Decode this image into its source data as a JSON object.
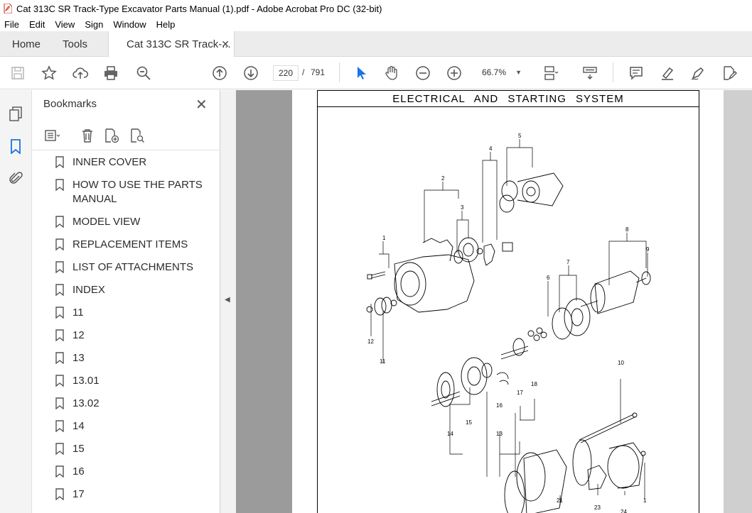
{
  "window": {
    "title": "Cat 313C SR Track-Type Excavator Parts Manual (1).pdf - Adobe Acrobat Pro DC (32-bit)"
  },
  "menu": [
    "File",
    "Edit",
    "View",
    "Sign",
    "Window",
    "Help"
  ],
  "tabs": {
    "home": "Home",
    "tools": "Tools",
    "document": "Cat 313C SR Track-..."
  },
  "toolbar": {
    "current_page": "220",
    "separator": "/",
    "total_pages": "791",
    "zoom": "66.7%"
  },
  "bookmarks": {
    "title": "Bookmarks",
    "items": [
      "INNER COVER",
      "HOW TO USE THE PARTS MANUAL",
      "MODEL VIEW",
      "REPLACEMENT ITEMS",
      "LIST OF ATTACHMENTS",
      "INDEX",
      "11",
      "12",
      "13",
      "13.01",
      "13.02",
      "14",
      "15",
      "16",
      "17"
    ]
  },
  "document": {
    "heading": "ELECTRICAL AND STARTING SYSTEM",
    "callouts": [
      "1",
      "2",
      "3",
      "4",
      "5",
      "6",
      "7",
      "8",
      "9",
      "10",
      "11",
      "12",
      "13",
      "14",
      "15",
      "16",
      "17",
      "18",
      "21",
      "23",
      "24",
      "1"
    ]
  },
  "colors": {
    "accent": "#1a73e8",
    "pdf_red": "#d7261f",
    "workspace_gray": "#9b9b9b"
  }
}
